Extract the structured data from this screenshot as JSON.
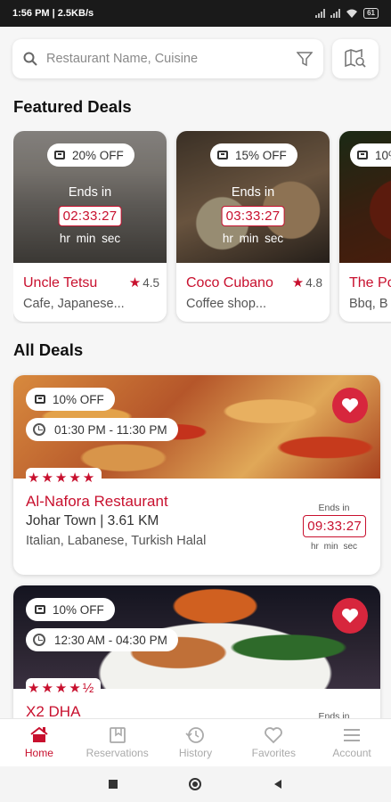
{
  "status_bar": {
    "time_speed": "1:56 PM | 2.5KB/s",
    "battery": "61"
  },
  "search": {
    "placeholder": "Restaurant Name, Cuisine"
  },
  "sections": {
    "featured_title": "Featured Deals",
    "all_title": "All Deals"
  },
  "featured": [
    {
      "discount": "20% OFF",
      "ends_label": "Ends in",
      "time": "02:33:27",
      "units": "hr min sec",
      "name": "Uncle Tetsu",
      "rating": "4.5",
      "cuisine": "Cafe, Japanese..."
    },
    {
      "discount": "15% OFF",
      "ends_label": "Ends in",
      "time": "03:33:27",
      "units": "hr min sec",
      "name": "Coco Cubano",
      "rating": "4.8",
      "cuisine": "Coffee shop..."
    },
    {
      "discount": "10%",
      "name": "The Po",
      "cuisine": "Bbq, B"
    }
  ],
  "deals": [
    {
      "discount": "10% OFF",
      "hours": "01:30 PM - 11:30 PM",
      "stars": "★★★★★",
      "name": "Al-Nafora Restaurant",
      "location": "Johar Town | 3.61 KM",
      "cuisine": "Italian, Labanese, Turkish Halal",
      "ends_label": "Ends in",
      "time": "09:33:27",
      "units": "hr min sec"
    },
    {
      "discount": "10% OFF",
      "hours": "12:30 AM - 04:30 PM",
      "stars": "★★★★½",
      "name": "X2 DHA",
      "ends_label": "Ends in"
    }
  ],
  "nav": {
    "home": "Home",
    "reservations": "Reservations",
    "history": "History",
    "favorites": "Favorites",
    "account": "Account"
  },
  "colors": {
    "accent": "#c8102e",
    "heart_bg": "#d7263d"
  },
  "icons": [
    "search-icon",
    "filter-icon",
    "map-search-icon",
    "tag-icon",
    "clock-icon",
    "heart-icon",
    "star-icon",
    "home-icon",
    "bookmark-icon",
    "history-icon",
    "favorite-icon",
    "menu-icon"
  ]
}
